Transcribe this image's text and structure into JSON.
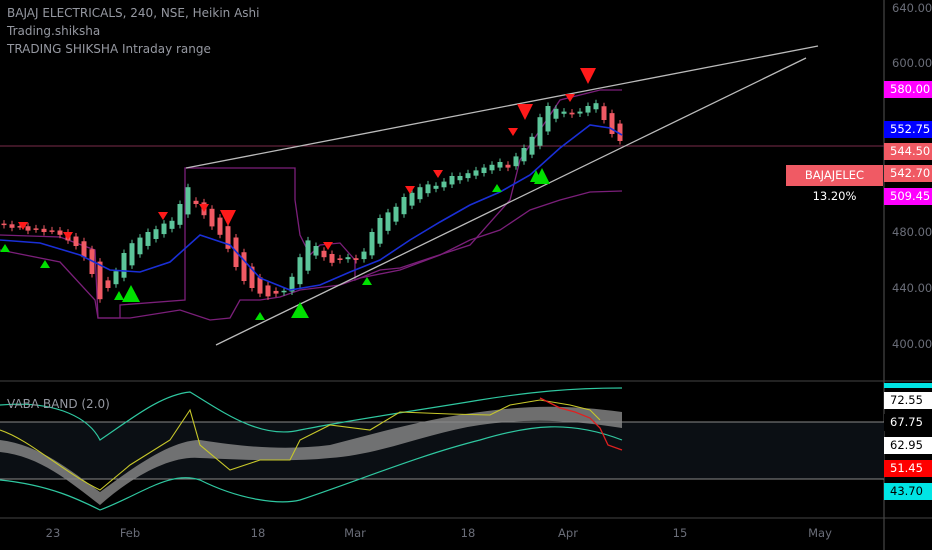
{
  "header": {
    "title": "BAJAJ ELECTRICALS, 240, NSE, Heikin Ashi",
    "indicator1": "Trading.shiksha",
    "indicator2": "TRADING SHIKSHA Intraday range"
  },
  "oscillator": {
    "title": "VABA BAND (2.0)"
  },
  "symbol_tag": "BAJAJELEC 13.20%",
  "colors": {
    "up": "#5cc59a",
    "down": "#f05a64",
    "ma": "#1a2fd6",
    "range": "#7b1f7a",
    "magenta": "#ff00ff",
    "blue": "#0000ff",
    "cyan": "#00e5e5"
  },
  "chart_data": {
    "type": "candlestick",
    "title": "BAJAJ ELECTRICALS, 240, NSE, Heikin Ashi",
    "ylim": [
      370,
      650
    ],
    "y_ticks": [
      "640.00",
      "600.00",
      "480.00",
      "440.00",
      "400.00"
    ],
    "x_ticks": [
      "23",
      "Feb",
      "18",
      "Mar",
      "18",
      "Apr",
      "15",
      "May"
    ],
    "closes": [
      485,
      483,
      484,
      481,
      482,
      480,
      481,
      478,
      474,
      470,
      462,
      450,
      432,
      440,
      452,
      465,
      472,
      476,
      480,
      482,
      486,
      488,
      500,
      512,
      500,
      492,
      484,
      478,
      468,
      455,
      445,
      440,
      436,
      434,
      436,
      438,
      448,
      462,
      474,
      470,
      462,
      458,
      460,
      462,
      460,
      466,
      480,
      490,
      494,
      498,
      505,
      508,
      512,
      514,
      513,
      516,
      520,
      520,
      522,
      524,
      526,
      528,
      530,
      526,
      534,
      540,
      548,
      562,
      570,
      568,
      566,
      564,
      566,
      570,
      572,
      560,
      550,
      545
    ],
    "price_labels": [
      {
        "text": "580.00",
        "value": 580,
        "bg": "#ff00ff",
        "fg": "#ffffff"
      },
      {
        "text": "552.75",
        "value": 552.75,
        "bg": "#0000ff",
        "fg": "#ffffff"
      },
      {
        "text": "544.50",
        "value": 544.5,
        "bg": "#f05a64",
        "fg": "#ffffff"
      },
      {
        "text": "542.70",
        "value": 542.7,
        "bg": "#f05a64",
        "fg": "#ffffff"
      },
      {
        "text": "509.45",
        "value": 509.45,
        "bg": "#ff00ff",
        "fg": "#ffffff"
      }
    ],
    "oscillator_labels": [
      {
        "text": "72.55",
        "bg": "#ffffff",
        "fg": "#000000"
      },
      {
        "text": "67.75",
        "bg": "#000000",
        "fg": "#ffffff"
      },
      {
        "text": "62.95",
        "bg": "#ffffff",
        "fg": "#000000"
      },
      {
        "text": "51.45",
        "bg": "#ff0000",
        "fg": "#ffffff"
      },
      {
        "text": "43.70",
        "bg": "#00e5e5",
        "fg": "#000000"
      }
    ]
  }
}
